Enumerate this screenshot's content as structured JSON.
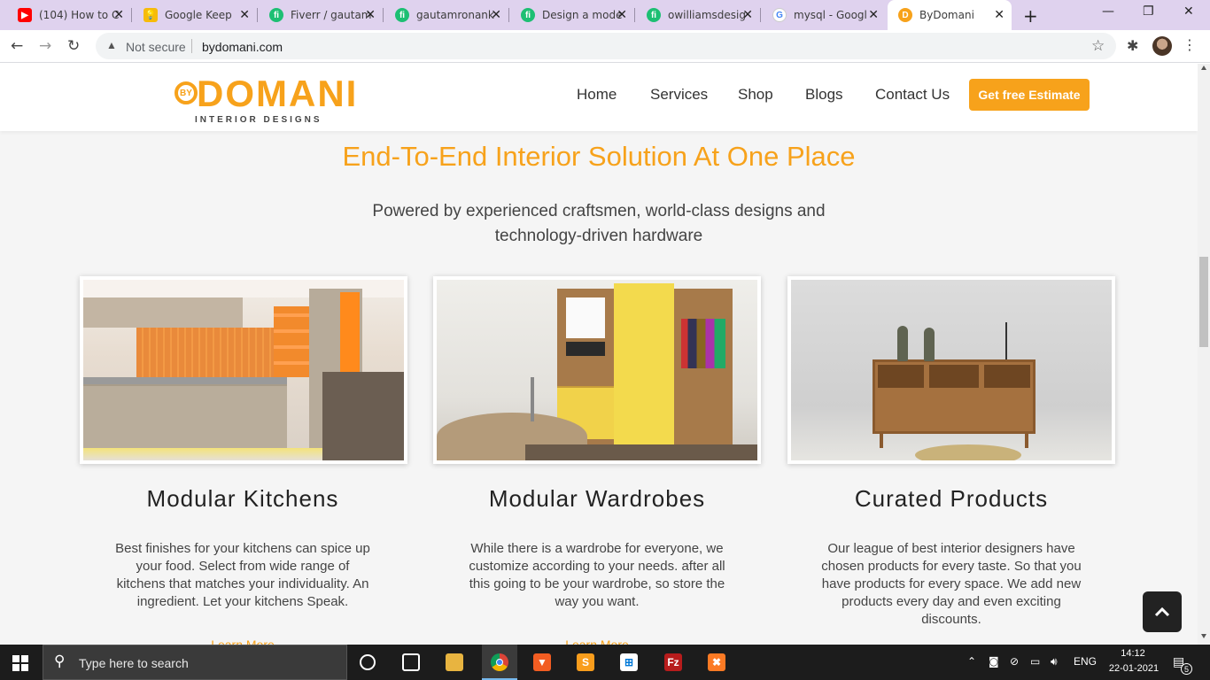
{
  "browser": {
    "tabs": [
      {
        "title": "(104) How to C",
        "icon": "youtube-icon",
        "color": "#ff0000"
      },
      {
        "title": "Google Keep",
        "icon": "keep-icon",
        "color": "#f6bb0a"
      },
      {
        "title": "Fiverr / gautam",
        "icon": "fiverr-icon",
        "color": "#1dbf73"
      },
      {
        "title": "gautamronank",
        "icon": "fiverr-icon",
        "color": "#1dbf73"
      },
      {
        "title": "Design a mode",
        "icon": "fiverr-icon",
        "color": "#1dbf73"
      },
      {
        "title": "owilliamsdesig",
        "icon": "fiverr-icon",
        "color": "#1dbf73"
      },
      {
        "title": "mysql - Googl",
        "icon": "google-icon",
        "color": "#4285f4"
      },
      {
        "title": "ByDomani",
        "icon": "bydomani-icon",
        "color": "#f7a21b"
      }
    ],
    "new_tab_glyph": "+",
    "minimize_glyph": "—",
    "maximize_glyph": "❐",
    "close_glyph": "✕",
    "security_label": "Not secure",
    "url": "bydomani.com"
  },
  "site": {
    "logo": {
      "badge": "BY",
      "name": "DOMANI",
      "tagline": "INTERIOR DESIGNS"
    },
    "nav": [
      "Home",
      "Services",
      "Shop",
      "Blogs",
      "Contact Us"
    ],
    "cta": "Get free Estimate",
    "hero_title": "End-To-End Interior Solution At One Place",
    "hero_subtitle": "Powered by experienced craftsmen, world-class designs and technology-driven hardware",
    "services": [
      {
        "title": "Modular Kitchens",
        "desc": "Best finishes for your kitchens can spice up your food. Select from wide range of kitchens that matches your individuality. An ingredient. Let your kitchens Speak.",
        "link": "Learn More"
      },
      {
        "title": "Modular Wardrobes",
        "desc": "While there is a wardrobe for everyone, we customize according to your needs. after all this going to be your wardrobe, so store the way you want.",
        "link": "Learn More"
      },
      {
        "title": "Curated Products",
        "desc": "Our league of best interior designers have chosen products for every taste. So that you have products for every space. We add new products every day and even exciting discounts.",
        "link": ""
      }
    ],
    "accent_color": "#f7a21b"
  },
  "taskbar": {
    "search_placeholder": "Type here to search",
    "language": "ENG",
    "time": "14:12",
    "date": "22-01-2021",
    "notifications": "5"
  }
}
